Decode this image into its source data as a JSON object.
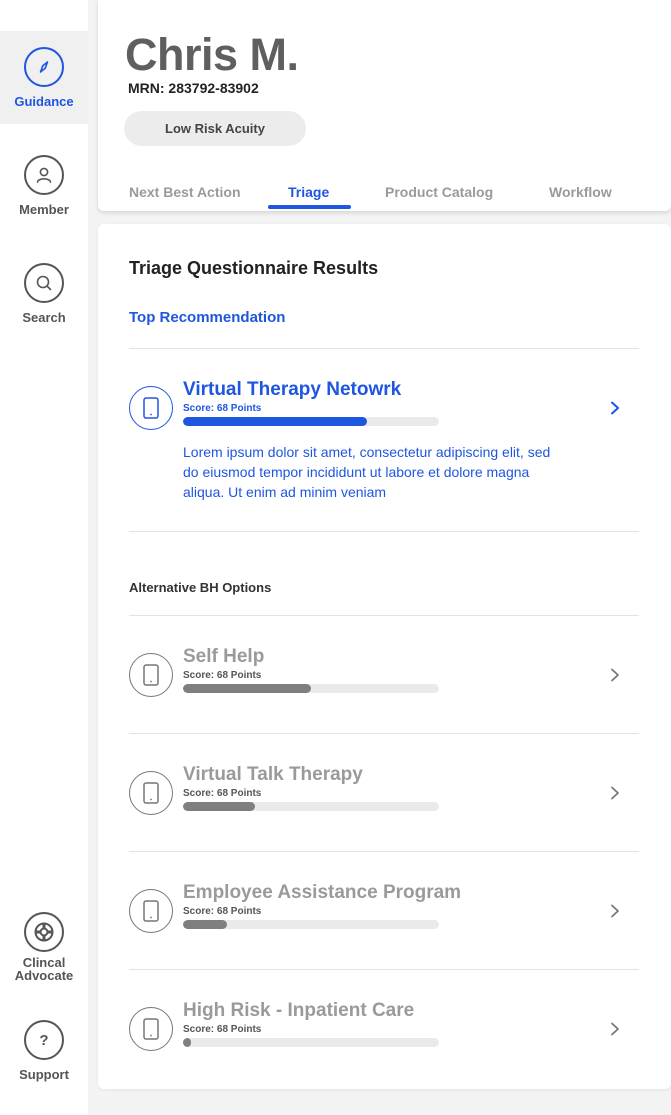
{
  "sidebar": {
    "items": [
      {
        "label": "Guidance",
        "icon": "compass-icon"
      },
      {
        "label": "Member",
        "icon": "person-icon"
      },
      {
        "label": "Search",
        "icon": "search-icon"
      },
      {
        "label_line1": "Clincal",
        "label_line2": "Advocate",
        "icon": "lifebuoy-icon"
      },
      {
        "label": "Support",
        "icon": "question-icon"
      }
    ]
  },
  "header": {
    "name": "Chris M.",
    "mrn": "MRN: 283792-83902",
    "risk_badge": "Low Risk Acuity",
    "tabs": [
      {
        "label": "Next Best Action"
      },
      {
        "label": "Triage"
      },
      {
        "label": "Product Catalog"
      },
      {
        "label": "Workflow"
      }
    ],
    "active_tab": "Triage"
  },
  "main": {
    "title": "Triage Questionnaire Results",
    "top_recommendation_label": "Top Recommendation",
    "top_option": {
      "name": "Virtual Therapy Netowrk",
      "score": "Score: 68 Points",
      "progress": 0.72,
      "description": "Lorem ipsum dolor sit amet, consectetur adipiscing elit, sed do eiusmod tempor incididunt ut labore et dolore magna aliqua. Ut enim ad minim veniam"
    },
    "alternatives_label": "Alternative BH Options",
    "alternatives": [
      {
        "name": "Self Help",
        "score": "Score: 68 Points",
        "progress": 0.5
      },
      {
        "name": "Virtual Talk Therapy",
        "score": "Score: 68 Points",
        "progress": 0.28
      },
      {
        "name": "Employee Assistance Program",
        "score": "Score: 68 Points",
        "progress": 0.17
      },
      {
        "name": "High Risk - Inpatient Care",
        "score": "Score: 68 Points",
        "progress": 0.03
      }
    ]
  },
  "colors": {
    "accent": "#1f56e0",
    "muted_text": "#9a9a9a",
    "bar_fill": "#7f7f7f",
    "bar_track": "#eaeaea",
    "background": "#f3f3f3"
  }
}
